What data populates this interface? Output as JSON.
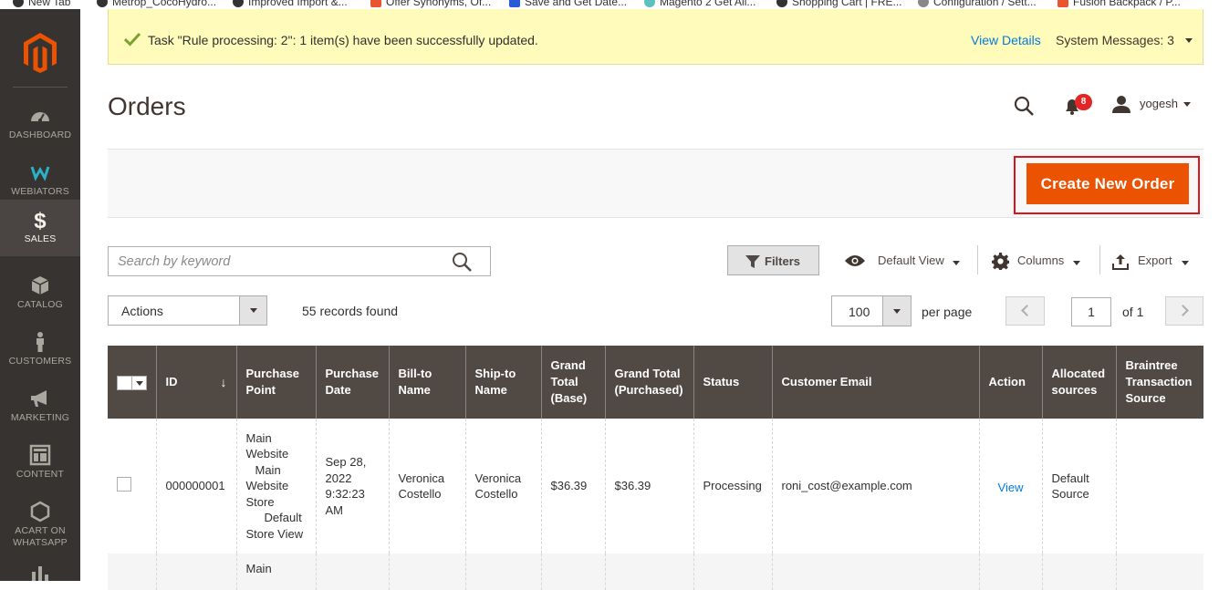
{
  "bookmarks": [
    {
      "label": "New Tab"
    },
    {
      "label": "Metrop_CocoHydro..."
    },
    {
      "label": "Improved Import &..."
    },
    {
      "label": "Offer Synonyms, Of..."
    },
    {
      "label": "Save and Get Date..."
    },
    {
      "label": "Magento 2 Get All..."
    },
    {
      "label": "Shopping Cart | FRE..."
    },
    {
      "label": "Configuration / Sett..."
    },
    {
      "label": "Fusion Backpack / P..."
    }
  ],
  "sidebar": {
    "items": [
      {
        "label": "DASHBOARD",
        "icon": "dashboard-icon"
      },
      {
        "label": "WEBIATORS",
        "icon": "webiators-icon"
      },
      {
        "label": "SALES",
        "icon": "dollar-icon",
        "active": true
      },
      {
        "label": "CATALOG",
        "icon": "box-icon"
      },
      {
        "label": "CUSTOMERS",
        "icon": "person-icon"
      },
      {
        "label": "MARKETING",
        "icon": "megaphone-icon"
      },
      {
        "label": "CONTENT",
        "icon": "layout-icon"
      },
      {
        "label": "ACART ON WHATSAPP",
        "icon": "hexagon-icon"
      },
      {
        "label": "",
        "icon": "bar-chart-icon"
      }
    ]
  },
  "message": {
    "text": "Task \"Rule processing: 2\": 1 item(s) have been successfully updated.",
    "view_details": "View Details",
    "system_messages": "System Messages: 3"
  },
  "header": {
    "title": "Orders",
    "notifications_count": "8",
    "user": "yogesh"
  },
  "actions_band": {
    "create_label": "Create New Order"
  },
  "toolbar": {
    "search_placeholder": "Search by keyword",
    "filters_label": "Filters",
    "view_label": "Default View",
    "columns_label": "Columns",
    "export_label": "Export",
    "mass_actions_label": "Actions",
    "records_found": "55 records found",
    "per_page_value": "100",
    "per_page_label": "per page",
    "page_value": "1",
    "page_of": "of 1"
  },
  "colors": {
    "accent": "#eb5202",
    "sidebar": "#373330",
    "table_header": "#514943",
    "link": "#007bdb",
    "highlight": "#d9161e"
  },
  "table": {
    "columns": [
      "ID",
      "Purchase Point",
      "Purchase Date",
      "Bill-to Name",
      "Ship-to Name",
      "Grand Total (Base)",
      "Grand Total (Purchased)",
      "Status",
      "Customer Email",
      "Action",
      "Allocated sources",
      "Braintree Transaction Source"
    ],
    "sort_arrow": "↓",
    "rows": [
      {
        "id": "000000001",
        "purchase_point": [
          "Main",
          "Website",
          "Main",
          "Website",
          "Store",
          "Default",
          "Store View"
        ],
        "purchase_date": [
          "Sep 28,",
          "2022",
          "9:32:23",
          "AM"
        ],
        "bill_to": [
          "Veronica",
          "Costello"
        ],
        "ship_to": [
          "Veronica",
          "Costello"
        ],
        "grand_total_base": "$36.39",
        "grand_total_purchased": "$36.39",
        "status": "Processing",
        "email": "roni_cost@example.com",
        "action": "View",
        "allocated": [
          "Default",
          "Source"
        ],
        "braintree": ""
      },
      {
        "purchase_point_first": "Main"
      }
    ]
  }
}
